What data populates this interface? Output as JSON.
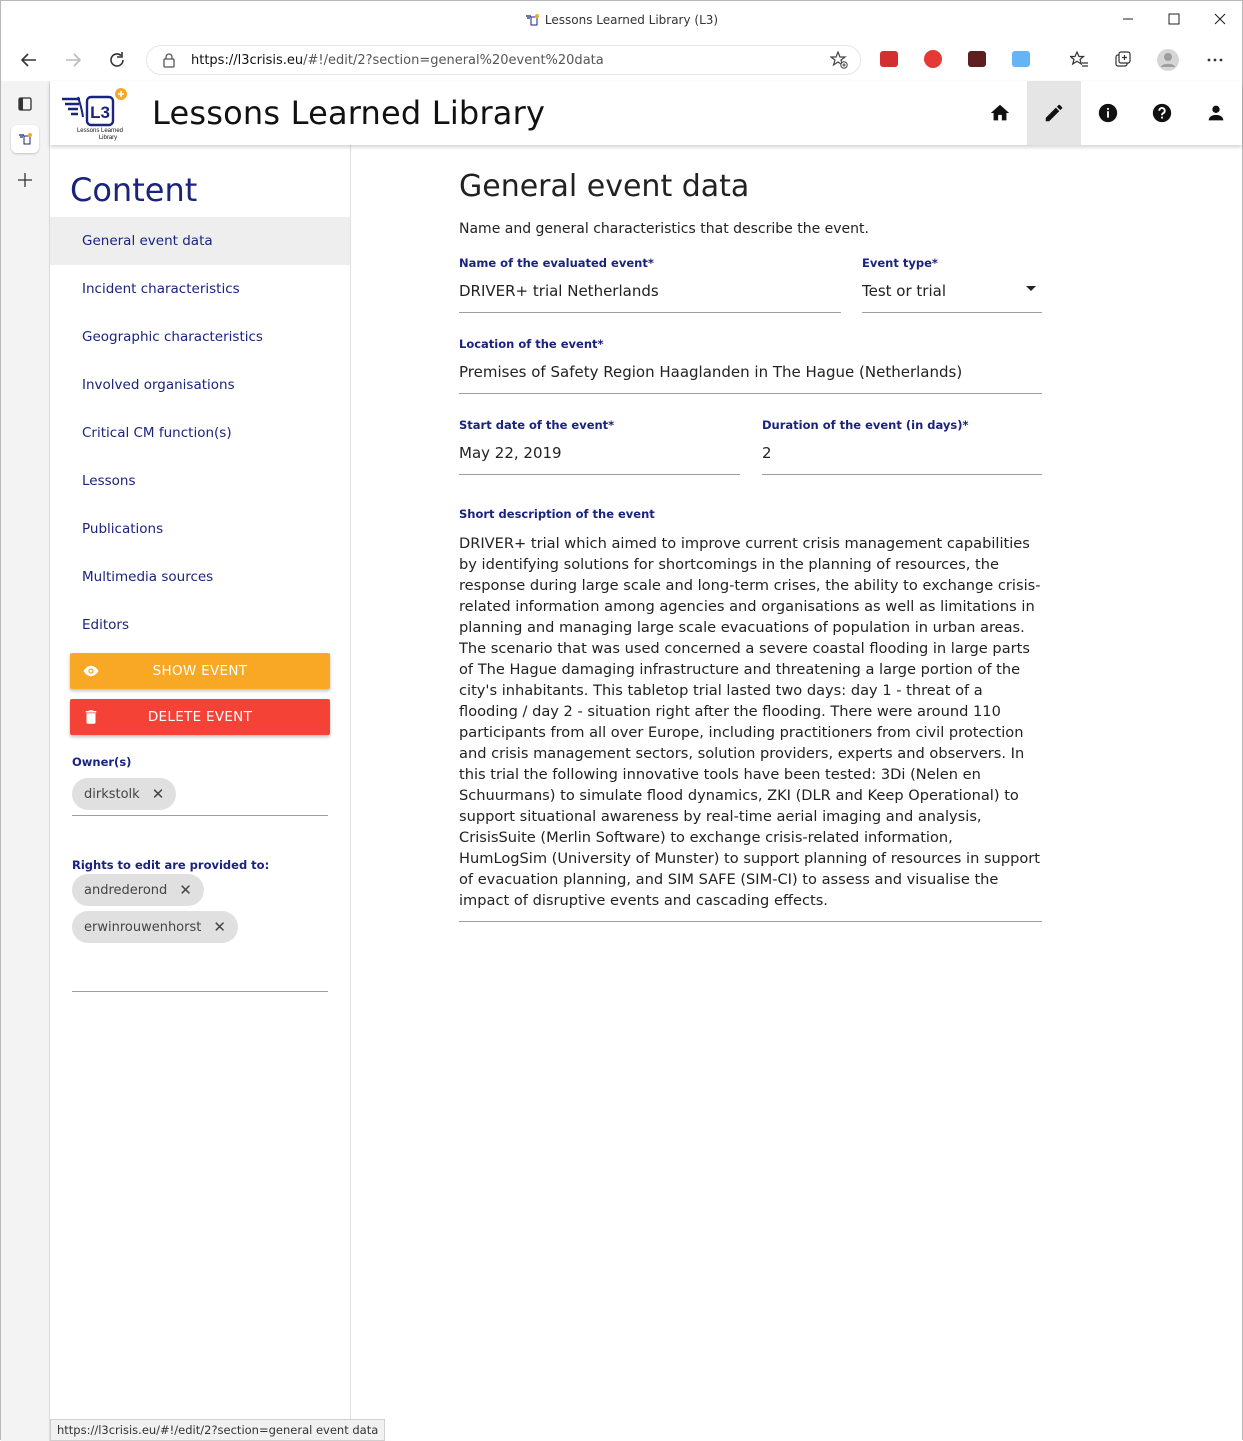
{
  "window": {
    "title": "Lessons Learned Library (L3)"
  },
  "browser": {
    "url_host": "https://l3crisis.eu",
    "url_path": "/#!/edit/2?section=general%20event%20data",
    "status_url": "https://l3crisis.eu/#!/edit/2?section=general event data"
  },
  "app": {
    "title": "Lessons Learned Library",
    "logo_text": "L3",
    "logo_caption_1": "Lessons Learned",
    "logo_caption_2": "Library",
    "nav_icons": [
      "home-icon",
      "edit-icon",
      "info-icon",
      "help-icon",
      "account-icon"
    ],
    "active_nav": "edit-icon"
  },
  "sidebar": {
    "heading": "Content",
    "items": [
      {
        "label": "General event data"
      },
      {
        "label": "Incident characteristics"
      },
      {
        "label": "Geographic characteristics"
      },
      {
        "label": "Involved organisations"
      },
      {
        "label": "Critical CM function(s)"
      },
      {
        "label": "Lessons"
      },
      {
        "label": "Publications"
      },
      {
        "label": "Multimedia sources"
      },
      {
        "label": "Editors"
      }
    ],
    "show_button": "SHOW EVENT",
    "delete_button": "DELETE EVENT",
    "owners_label": "Owner(s)",
    "owners": [
      "dirkstolk"
    ],
    "rights_label": "Rights to edit are provided to:",
    "editors": [
      "andrederond",
      "erwinrouwenhorst"
    ]
  },
  "main": {
    "title": "General event data",
    "subtitle": "Name and general characteristics that describe the event.",
    "name_label": "Name of the evaluated event*",
    "name_value": "DRIVER+ trial Netherlands",
    "type_label": "Event type*",
    "type_value": "Test or trial",
    "location_label": "Location of the event*",
    "location_value": "Premises of Safety Region Haaglanden in The Hague (Netherlands)",
    "start_label": "Start date of the event*",
    "start_value": "May 22, 2019",
    "duration_label": "Duration of the event (in days)*",
    "duration_value": "2",
    "desc_label": "Short description of the event",
    "desc_value": "DRIVER+ trial which aimed to improve current crisis management capabilities by identifying solutions for shortcomings in the planning of resources, the response during large scale and long-term crises, the ability to exchange crisis-related information among agencies and organisations as well as limitations in planning and managing large scale evacuations of population in urban areas. The scenario that was used concerned a severe coastal flooding in large parts of The Hague damaging infrastructure and threatening a large portion of the city's inhabitants. This tabletop trial lasted two days: day 1 - threat of a flooding / day 2 - situation right after the flooding. There were around 110 participants from all over Europe, including practitioners from civil protection and crisis management sectors, solution providers, experts and observers. In this trial the following innovative tools have been tested: 3Di (Nelen en Schuurmans) to simulate flood dynamics, ZKI (DLR and Keep Operational)  to support situational awareness by real-time aerial imaging and analysis, CrisisSuite (Merlin Software) to exchange crisis-related information, HumLogSim (University of Munster) to support planning of resources in  support of evacuation planning, and SIM SAFE (SIM-CI) to assess and visualise the impact of disruptive events and cascading effects."
  },
  "colors": {
    "primary": "#1a237e",
    "show_button": "#f9a825",
    "delete_button": "#f44336"
  }
}
